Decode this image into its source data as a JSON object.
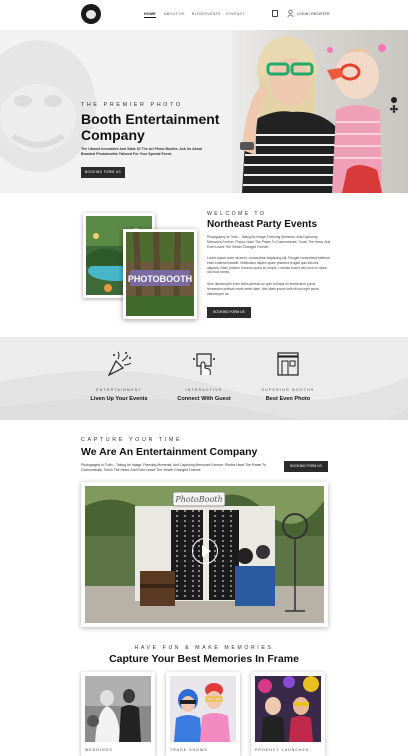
{
  "header": {
    "nav": [
      "HOME",
      "ABOUT US",
      "BLOG/EVENTS",
      "CONTACT"
    ],
    "login": "LOGIN / REGISTER"
  },
  "hero": {
    "eyebrow": "THE PREMIER PHOTO",
    "title": "Booth Entertainment Company",
    "description": "The Utmost Innovative And State Of The Art Photo Booths.   Ask Us About Branded Photobooths Tailored For Your Special Event.",
    "button": "BOOKING FORM US"
  },
  "about": {
    "eyebrow": "WELCOME TO",
    "title": "Northeast Party Events",
    "paragraphs": [
      "Photography Is Truth – Taking An Image, Freezing Moments, And Capturing Memories Forever.  Photos Have The Power To Communicate, Touch The Heart, And Even Leave The Viewer Changed Forever.",
      "Lorem ipsum dolor sit amet, consectetur adipiscing elit. Feugiat consectetur eleifend enim euismod blandit. Vestibulum sapien quam pharetra feugiat quis lobortis aliquam. Diam pretium rhoncus quam eu neque. Lobortis erat id sed mus eu netus dui risus fames.",
      "Sem ullamcorper enim tellus aenean ac quis volutpat mi elementum purus fermentum pretium morbi amet diam. Nec diam ipsum velit sit nisl eget purus ullamcorper ac."
    ],
    "button": "BOOKING FORM US",
    "image_caption": "PHOTOBOOTH"
  },
  "services": [
    {
      "eyebrow": "ENTERTAINMENT",
      "title": "Liven Up Your Events",
      "icon": "party-popper-icon"
    },
    {
      "eyebrow": "INTERACTIVE",
      "title": "Connect With Guest",
      "icon": "touch-screen-icon"
    },
    {
      "eyebrow": "SUPERIOR BOOTHS",
      "title": "Best Even Photo",
      "icon": "photo-booth-icon"
    }
  ],
  "entertainment": {
    "eyebrow": "CAPTURE YOUR TIME",
    "title": "We Are An Entertainment Company",
    "description": "Photography Is Truth – Taking An Image, Freezing Moments, And Capturing  Memories Forever.  Photos Have The Power To Communicate, Touch The Heart, And Even Leave The Viewer Changed Forever.",
    "button": "BOOKING FORM US",
    "booth_sign": "PhotoBooth"
  },
  "memories": {
    "eyebrow": "HAVE FUN & MAKE MEMORIES",
    "title": "Capture Your Best Memories In Frame",
    "cards": [
      {
        "label": "WEDDINGS"
      },
      {
        "label": "TRADE SHOWS"
      },
      {
        "label": "PRODUCT LAUNCHES"
      }
    ]
  },
  "colors": {
    "dark": "#2b2b2b",
    "band": "#ececec",
    "hero_bg": "#f2f2f2"
  }
}
